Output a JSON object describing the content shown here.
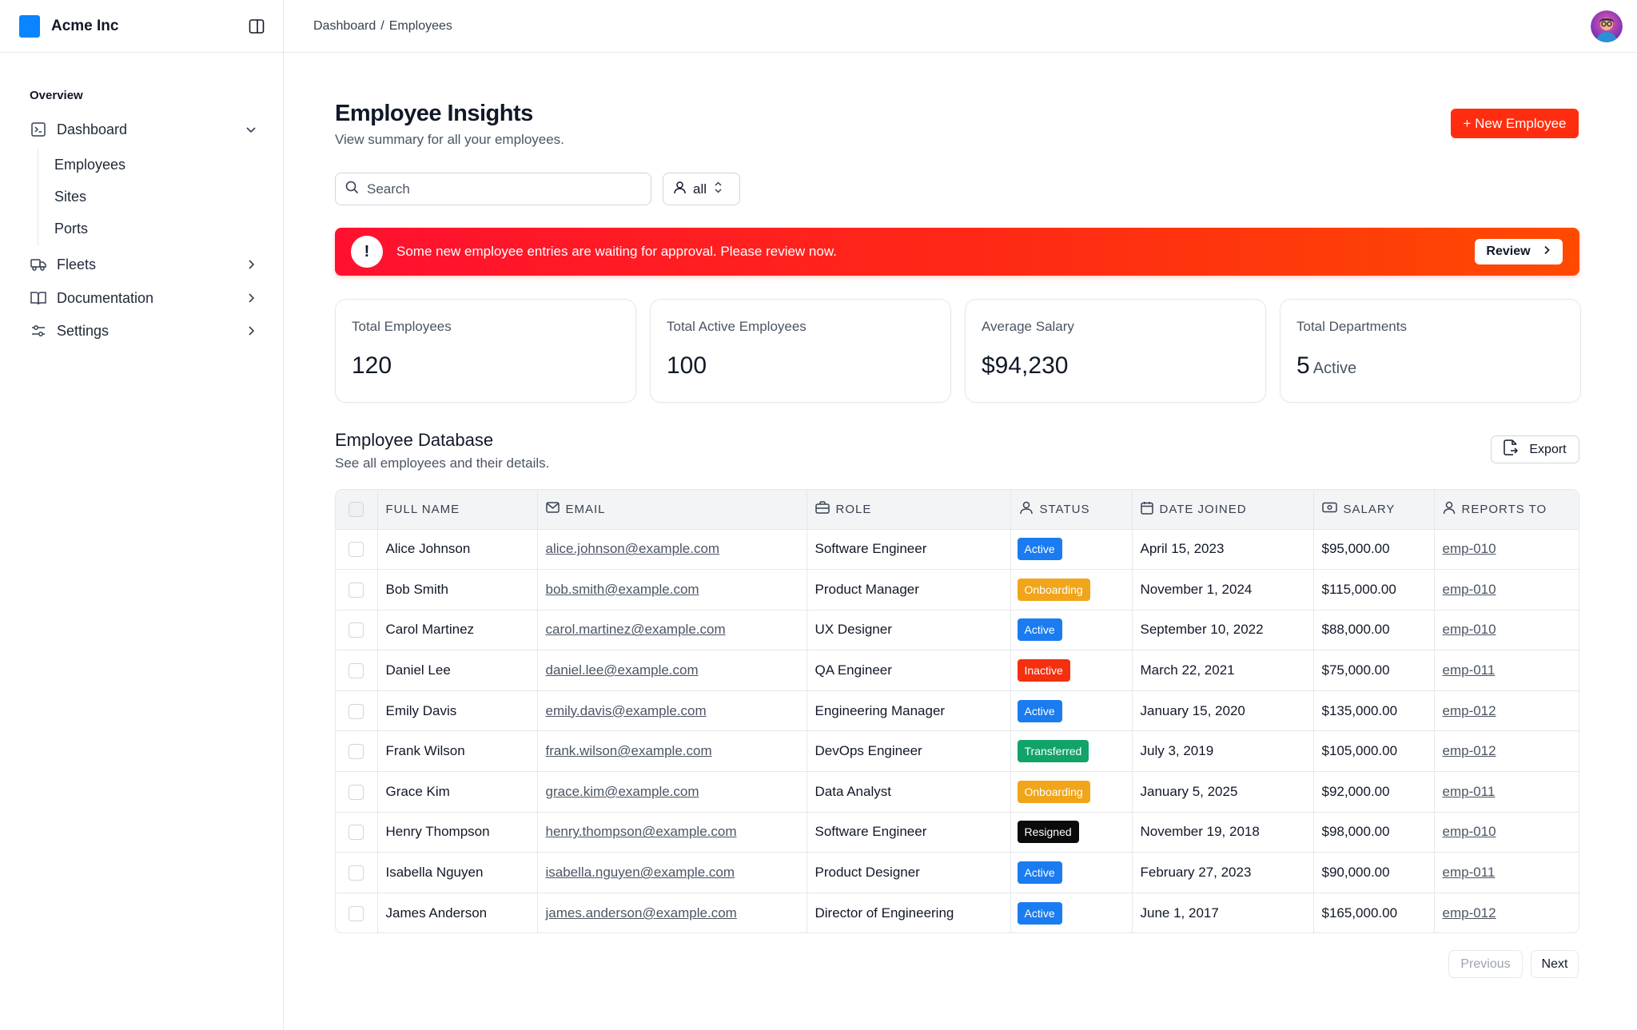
{
  "brand": {
    "name": "Acme Inc",
    "color": "#0a84ff"
  },
  "breadcrumb": {
    "parent": "Dashboard",
    "separator": "/",
    "current": "Employees"
  },
  "sidebar": {
    "section_title": "Overview",
    "items": [
      {
        "label": "Dashboard",
        "icon": "terminal-square-icon",
        "expanded": true
      },
      {
        "label": "Fleets",
        "icon": "truck-icon"
      },
      {
        "label": "Documentation",
        "icon": "book-open-icon"
      },
      {
        "label": "Settings",
        "icon": "sliders-icon"
      }
    ],
    "sub_items": [
      "Employees",
      "Sites",
      "Ports"
    ]
  },
  "header": {
    "title": "Employee Insights",
    "subtitle": "View summary for all your employees.",
    "new_button": "+ New Employee"
  },
  "filters": {
    "search_placeholder": "Search",
    "select_value": "all"
  },
  "alert": {
    "text": "Some new employee entries are waiting for approval. Please review now.",
    "icon_text": "!",
    "button": "Review"
  },
  "stats": [
    {
      "label": "Total Employees",
      "value": "120",
      "suffix": ""
    },
    {
      "label": "Total Active Employees",
      "value": "100",
      "suffix": ""
    },
    {
      "label": "Average Salary",
      "value": "$94,230",
      "suffix": ""
    },
    {
      "label": "Total Departments",
      "value": "5",
      "suffix": "Active"
    }
  ],
  "database": {
    "title": "Employee Database",
    "subtitle": "See all employees and their details.",
    "export_button": "Export",
    "columns": [
      "FULL NAME",
      "EMAIL",
      "ROLE",
      "STATUS",
      "DATE JOINED",
      "SALARY",
      "REPORTS TO"
    ],
    "rows": [
      {
        "name": "Alice Johnson",
        "email": "alice.johnson@example.com",
        "role": "Software Engineer",
        "status": "Active",
        "date": "April 15, 2023",
        "salary": "$95,000.00",
        "reports_to": "emp-010"
      },
      {
        "name": "Bob Smith",
        "email": "bob.smith@example.com",
        "role": "Product Manager",
        "status": "Onboarding",
        "date": "November 1, 2024",
        "salary": "$115,000.00",
        "reports_to": "emp-010"
      },
      {
        "name": "Carol Martinez",
        "email": "carol.martinez@example.com",
        "role": "UX Designer",
        "status": "Active",
        "date": "September 10, 2022",
        "salary": "$88,000.00",
        "reports_to": "emp-010"
      },
      {
        "name": "Daniel Lee",
        "email": "daniel.lee@example.com",
        "role": "QA Engineer",
        "status": "Inactive",
        "date": "March 22, 2021",
        "salary": "$75,000.00",
        "reports_to": "emp-011"
      },
      {
        "name": "Emily Davis",
        "email": "emily.davis@example.com",
        "role": "Engineering Manager",
        "status": "Active",
        "date": "January 15, 2020",
        "salary": "$135,000.00",
        "reports_to": "emp-012"
      },
      {
        "name": "Frank Wilson",
        "email": "frank.wilson@example.com",
        "role": "DevOps Engineer",
        "status": "Transferred",
        "date": "July 3, 2019",
        "salary": "$105,000.00",
        "reports_to": "emp-012"
      },
      {
        "name": "Grace Kim",
        "email": "grace.kim@example.com",
        "role": "Data Analyst",
        "status": "Onboarding",
        "date": "January 5, 2025",
        "salary": "$92,000.00",
        "reports_to": "emp-011"
      },
      {
        "name": "Henry Thompson",
        "email": "henry.thompson@example.com",
        "role": "Software Engineer",
        "status": "Resigned",
        "date": "November 19, 2018",
        "salary": "$98,000.00",
        "reports_to": "emp-010"
      },
      {
        "name": "Isabella Nguyen",
        "email": "isabella.nguyen@example.com",
        "role": "Product Designer",
        "status": "Active",
        "date": "February 27, 2023",
        "salary": "$90,000.00",
        "reports_to": "emp-011"
      },
      {
        "name": "James Anderson",
        "email": "james.anderson@example.com",
        "role": "Director of Engineering",
        "status": "Active",
        "date": "June 1, 2017",
        "salary": "$165,000.00",
        "reports_to": "emp-012"
      }
    ]
  },
  "status_colors": {
    "Active": "#1a7cf0",
    "Onboarding": "#f0a51a",
    "Inactive": "#f4300f",
    "Transferred": "#12a36a",
    "Resigned": "#0a0a0a"
  },
  "pagination": {
    "previous": "Previous",
    "next": "Next"
  },
  "colors": {
    "accent": "#ff2d0f",
    "alert_start": "#ff1030",
    "alert_end": "#ff4a00"
  }
}
